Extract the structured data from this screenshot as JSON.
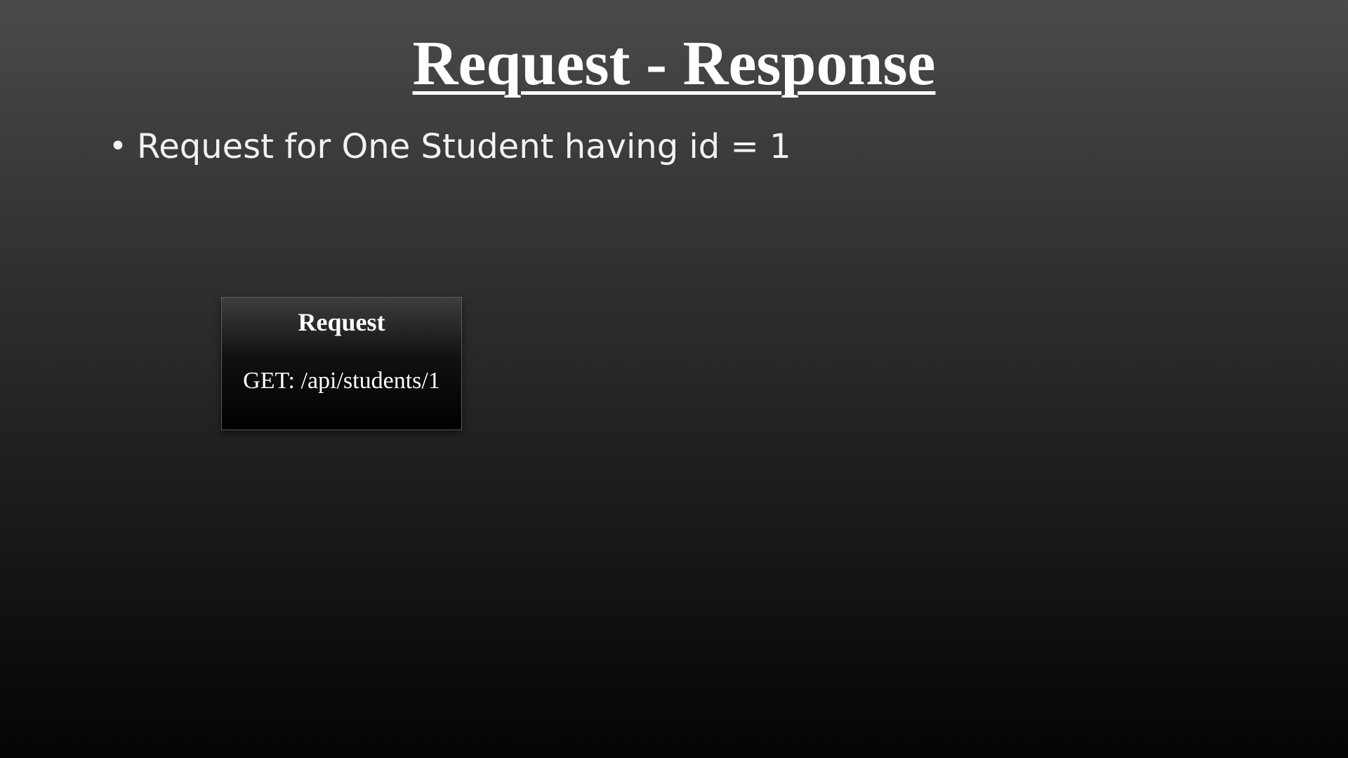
{
  "slide": {
    "title": "Request - Response",
    "bullets": [
      {
        "bullet": "•",
        "text": "Request for One Student having id = 1"
      }
    ],
    "request_box": {
      "heading": "Request",
      "body": "GET: /api/students/1"
    }
  }
}
